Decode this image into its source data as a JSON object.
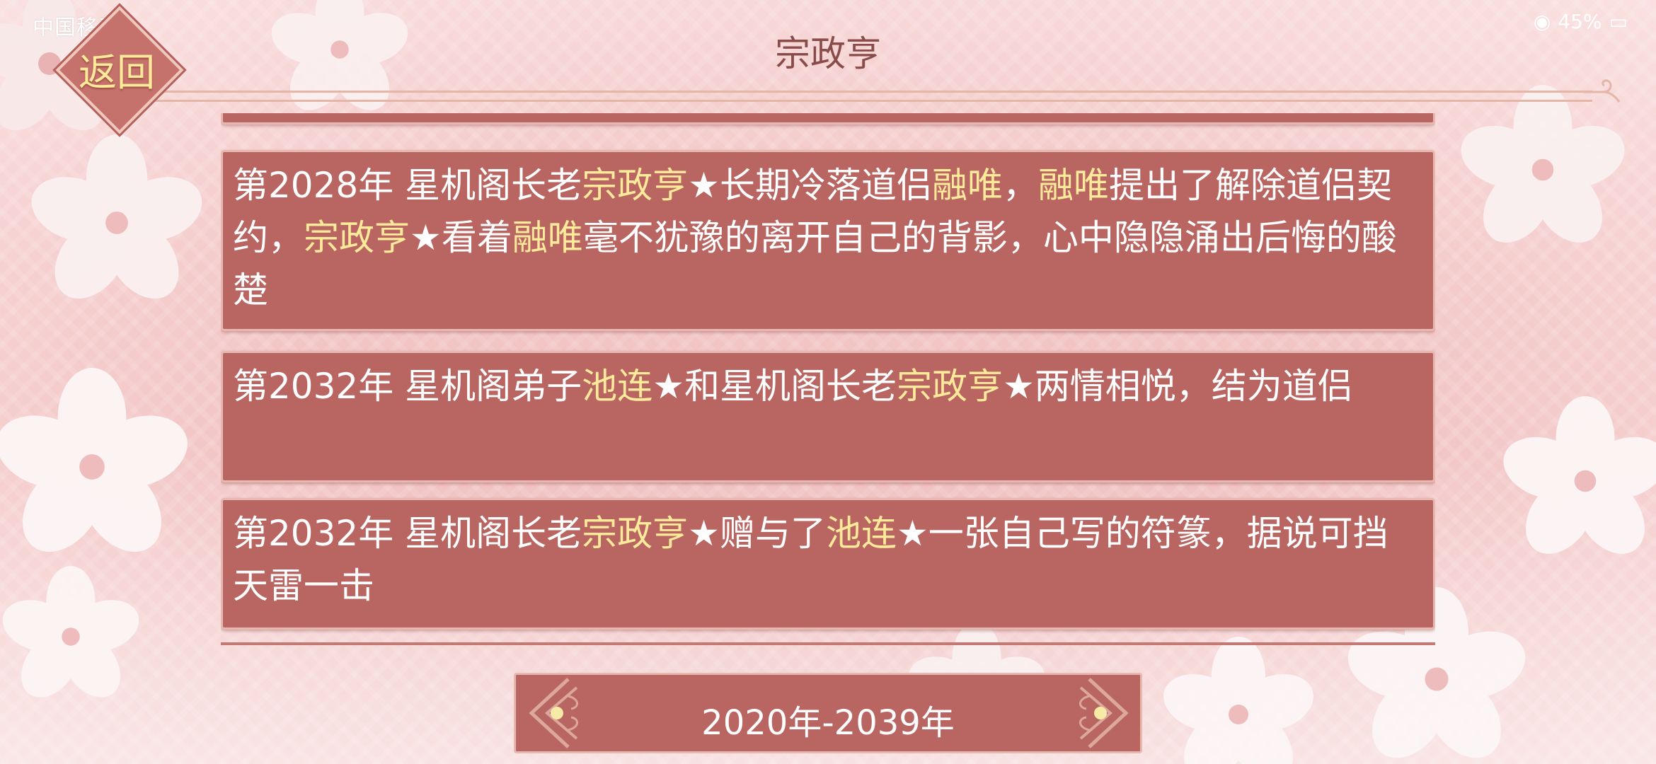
{
  "status_bar": {
    "carrier": "中国移动",
    "right": "45%"
  },
  "header": {
    "back_label": "返回",
    "title": "宗政亨"
  },
  "events": [
    {
      "parts": [
        {
          "text": "第2028年 星机阁长老",
          "hl": false
        },
        {
          "text": "宗政亨",
          "hl": true
        },
        {
          "text": "★长期冷落道侣",
          "hl": false
        },
        {
          "text": "融唯",
          "hl": true
        },
        {
          "text": "，",
          "hl": false
        },
        {
          "text": "融唯",
          "hl": true
        },
        {
          "text": "提出了解除道侣契约，",
          "hl": false
        },
        {
          "text": "宗政亨",
          "hl": true
        },
        {
          "text": "★看着",
          "hl": false
        },
        {
          "text": "融唯",
          "hl": true
        },
        {
          "text": "毫不犹豫的离开自己的背影，心中隐隐涌出后悔的酸楚",
          "hl": false
        }
      ]
    },
    {
      "parts": [
        {
          "text": "第2032年 星机阁弟子",
          "hl": false
        },
        {
          "text": "池连",
          "hl": true
        },
        {
          "text": "★和星机阁长老",
          "hl": false
        },
        {
          "text": "宗政亨",
          "hl": true
        },
        {
          "text": "★两情相悦，结为道侣",
          "hl": false
        }
      ]
    },
    {
      "parts": [
        {
          "text": "第2032年 星机阁长老",
          "hl": false
        },
        {
          "text": "宗政亨",
          "hl": true
        },
        {
          "text": "★赠与了",
          "hl": false
        },
        {
          "text": "池连",
          "hl": true
        },
        {
          "text": "★一张自己写的符篆，据说可挡天雷一击",
          "hl": false
        }
      ]
    }
  ],
  "period_selector": {
    "label": "2020年-2039年",
    "prev_icon": "left-ornament-arrow",
    "next_icon": "right-ornament-arrow"
  },
  "colors": {
    "card_bg": "#b96561",
    "highlight": "#ffe99a",
    "title": "#8a4c48"
  }
}
